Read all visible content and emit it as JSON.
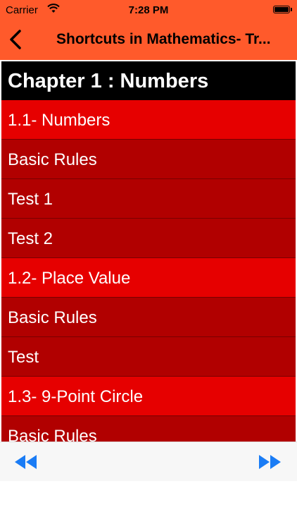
{
  "status_bar": {
    "carrier": "Carrier",
    "time": "7:28 PM"
  },
  "nav": {
    "title": "Shortcuts in Mathematics- Tr...",
    "back_icon": "chevron-left-icon"
  },
  "chapter": {
    "title": "Chapter 1 : Numbers"
  },
  "list": {
    "items": [
      {
        "label": "1.1- Numbers",
        "kind": "section"
      },
      {
        "label": "Basic Rules",
        "kind": "item"
      },
      {
        "label": "Test 1",
        "kind": "item"
      },
      {
        "label": "Test 2",
        "kind": "item"
      },
      {
        "label": "1.2- Place Value",
        "kind": "section"
      },
      {
        "label": "Basic Rules",
        "kind": "item"
      },
      {
        "label": "Test",
        "kind": "item"
      },
      {
        "label": "1.3- 9-Point Circle",
        "kind": "section"
      },
      {
        "label": "Basic Rules",
        "kind": "item"
      }
    ]
  },
  "toolbar": {
    "left_icon": "rewind-icon",
    "right_icon": "fast-forward-icon"
  },
  "colors": {
    "header_bg": "#ff5a2b",
    "section_bg": "#e60000",
    "item_bg": "#b10000",
    "chapter_bg": "#000000",
    "toolbar_icon": "#1a7cf5"
  }
}
